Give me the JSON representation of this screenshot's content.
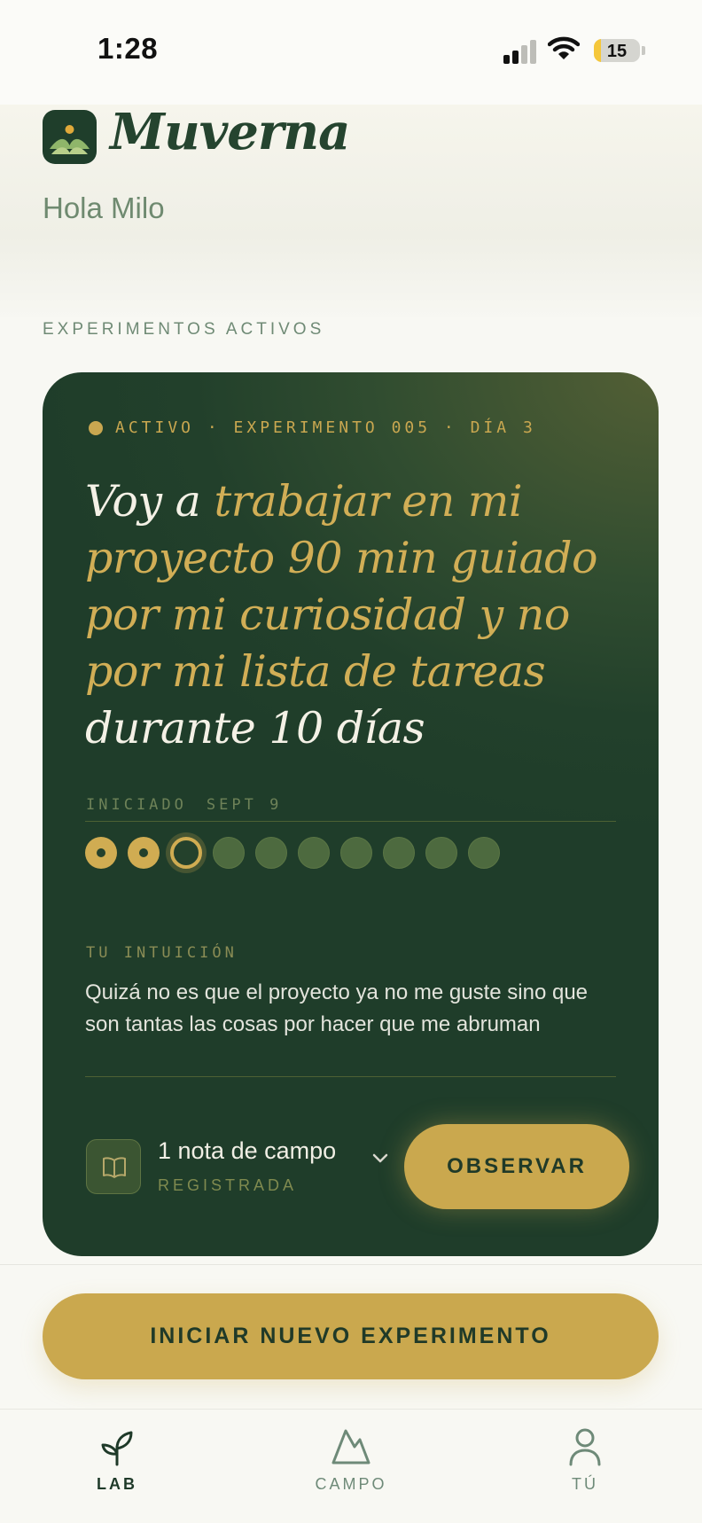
{
  "status_bar": {
    "time": "1:28",
    "battery": "15",
    "battery_level": 0.15
  },
  "brand": {
    "name": "Muverna"
  },
  "greeting": "Hola Milo",
  "section_label": "EXPERIMENTOS ACTIVOS",
  "experiment": {
    "meta": "ACTIVO · EXPERIMENTO 005 · DÍA 3",
    "title": {
      "lead": "Voy a ",
      "highlight": "trabajar en mi proyecto 90 min guiado por mi curiosidad y no por mi lista de tareas",
      "tail": " durante 10 días"
    },
    "started_label": "INICIADO",
    "started_date": "SEPT 9",
    "progress": {
      "completed": 2,
      "current": 3,
      "total": 10
    },
    "intuition_label": "TU INTUICIÓN",
    "intuition_text": "Quizá no es que el proyecto ya no me guste sino que son tantas las cosas por hacer que me abruman",
    "notes_title": "1 nota de campo",
    "notes_sub": "REGISTRADA",
    "notes_icon": "book-icon",
    "observe_label": "OBSERVAR"
  },
  "new_experiment_label": "INICIAR NUEVO EXPERIMENTO",
  "tabs": [
    {
      "label": "LAB",
      "icon": "sprout-icon",
      "active": true
    },
    {
      "label": "CAMPO",
      "icon": "mountain-icon",
      "active": false
    },
    {
      "label": "TÚ",
      "icon": "person-icon",
      "active": false
    }
  ],
  "colors": {
    "card_green": "#22402b",
    "accent_gold": "#caa84e",
    "brand_green": "#25442f"
  }
}
